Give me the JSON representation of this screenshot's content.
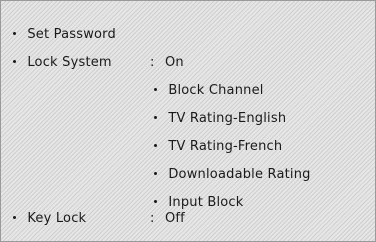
{
  "menu": {
    "set_password": "Set Password",
    "lock_system": {
      "label": "Lock System",
      "value": "On",
      "sub_items": [
        "Block Channel",
        "TV Rating-English",
        "TV Rating-French",
        "Downloadable Rating",
        "Input Block"
      ]
    },
    "key_lock": {
      "label": "Key Lock",
      "value": "Off"
    },
    "separator": ":"
  }
}
